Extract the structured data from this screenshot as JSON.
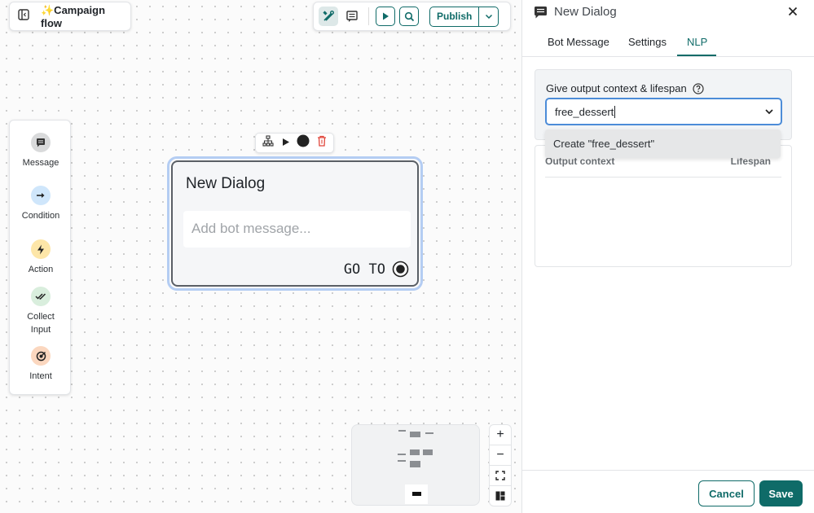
{
  "header": {
    "title": "✨Campaign flow"
  },
  "toolbar": {
    "publish_label": "Publish"
  },
  "palette": {
    "items": [
      {
        "label": "Message",
        "icon": "message-icon",
        "color": "#d9dadb"
      },
      {
        "label": "Condition",
        "icon": "arrow-right-icon",
        "color": "#cfe6fb"
      },
      {
        "label": "Action",
        "icon": "lightning-icon",
        "color": "#fde6a8"
      },
      {
        "label": "Collect Input",
        "icon": "double-check-icon",
        "color": "#d9eedd"
      },
      {
        "label": "Intent",
        "icon": "target-icon",
        "color": "#fbd7bf"
      }
    ]
  },
  "node": {
    "title": "New Dialog",
    "message_placeholder": "Add bot message...",
    "goto_label": "GO TO"
  },
  "panel": {
    "title": "New Dialog",
    "tabs": [
      {
        "label": "Bot Message",
        "active": false
      },
      {
        "label": "Settings",
        "active": false
      },
      {
        "label": "NLP",
        "active": true
      }
    ],
    "context_label": "Give output context & lifespan",
    "context_value": "free_dessert",
    "dropdown_option": "Create \"free_dessert\"",
    "table_headers": [
      "Output context",
      "Lifespan"
    ],
    "cancel_label": "Cancel",
    "save_label": "Save"
  },
  "colors": {
    "accent": "#0f6b68",
    "focus": "#4c8cd8",
    "node_selection": "#b4cdf3"
  }
}
